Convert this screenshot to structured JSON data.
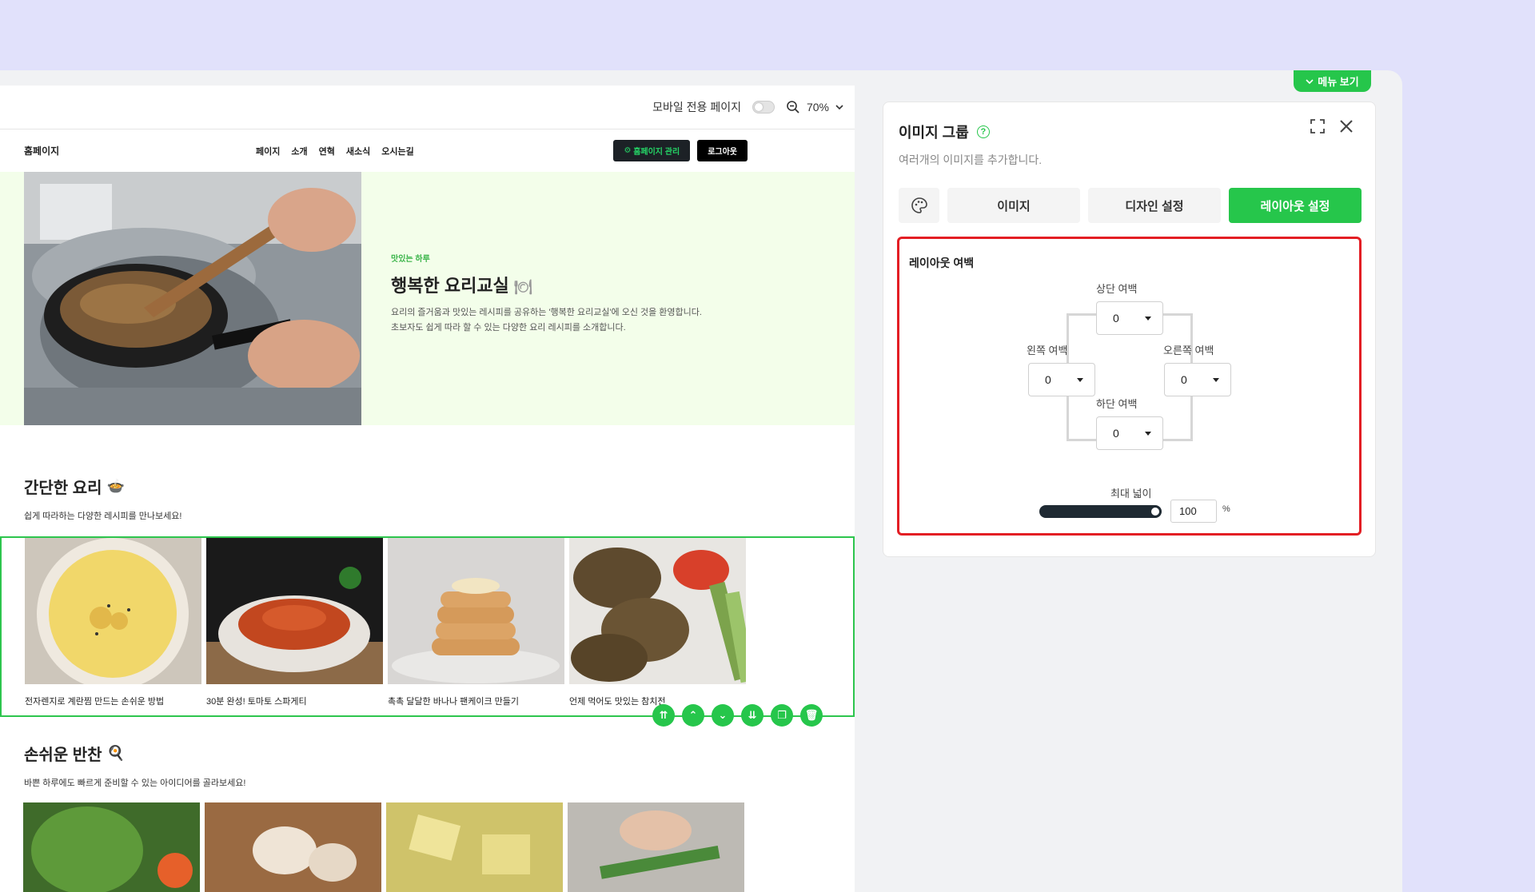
{
  "preview": {
    "mobile_label": "모바일 전용 페이지",
    "zoom": "70%",
    "site": {
      "logo": "홈페이지",
      "menu": [
        "페이지",
        "소개",
        "연혁",
        "새소식",
        "오시는길"
      ],
      "manage_btn": "홈페이지 관리",
      "logout_btn": "로그아웃"
    },
    "hero": {
      "kicker": "맛있는 하루",
      "title": "행복한 요리교실",
      "desc_line1": "요리의 즐거움과 맛있는 레시피를 공유하는 '행복한 요리교실'에 오신 것을 환영합니다.",
      "desc_line2": "초보자도 쉽게 따라 할 수 있는 다양한 요리 레시피를 소개합니다."
    },
    "section1": {
      "title": "간단한 요리",
      "subtitle": "쉽게 따라하는 다양한 레시피를 만나보세요!",
      "items": [
        "전자렌지로 계란찜 만드는 손쉬운 방법",
        "30분 완성! 토마토 스파게티",
        "촉촉 달달한 바나나 팬케이크 만들기",
        "언제 먹어도 맛있는 참치전"
      ]
    },
    "section2": {
      "title": "손쉬운 반찬",
      "subtitle": "바쁜 하루에도 빠르게 준비할 수 있는 아이디어를 골라보세요!"
    }
  },
  "panel": {
    "menu_view": "메뉴 보기",
    "title": "이미지 그룹",
    "desc": "여러개의 이미지를 추가합니다.",
    "tabs": [
      "이미지",
      "디자인 설정",
      "레이아웃 설정"
    ],
    "layout": {
      "title": "레이아웃 여백",
      "top_label": "상단 여백",
      "left_label": "왼쪽 여백",
      "right_label": "오른쪽 여백",
      "bottom_label": "하단 여백",
      "top": "0",
      "left": "0",
      "right": "0",
      "bottom": "0",
      "max_width_label": "최대 넓이",
      "max_width": "100",
      "unit": "%"
    }
  }
}
